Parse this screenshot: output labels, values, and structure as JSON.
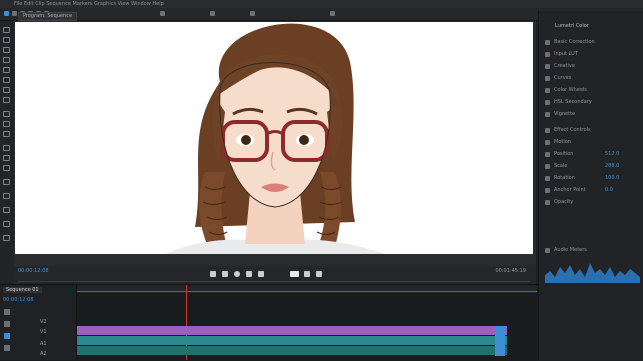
{
  "app": {
    "title": "Adobe Premiere Pro",
    "menu_text": "File  Edit  Clip  Sequence  Markers  Graphics  View  Window  Help"
  },
  "tabs": {
    "program": "Program: Sequence",
    "source": "Source"
  },
  "transport": {
    "timecode": "00:00:12:08",
    "duration": "00:01:45:19"
  },
  "right_panel": {
    "header": "Lumetri Color",
    "items": [
      "Basic Correction",
      "Input LUT",
      "Creative",
      "Curves",
      "Color Wheels",
      "HSL Secondary",
      "Vignette",
      "Effect Controls",
      "Motion",
      "Position",
      "Scale",
      "Rotation",
      "Anchor Point",
      "Opacity",
      "Audio Meters"
    ],
    "values": [
      "512.0",
      "288.0",
      "100.0",
      "0.0"
    ]
  },
  "timeline": {
    "sequence_tab": "Sequence 01",
    "timecode": "00:00:12:08",
    "tracks": [
      "V2",
      "V1",
      "A1",
      "A2"
    ]
  },
  "colors": {
    "accent": "#3b8fd6",
    "clip_purple": "#9b5fc0",
    "clip_teal": "#2d8a8a",
    "playhead": "#d6332b"
  }
}
